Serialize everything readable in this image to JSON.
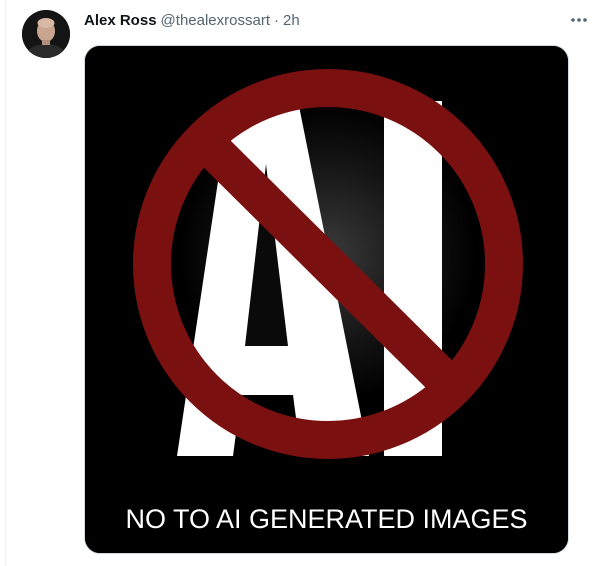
{
  "tweet": {
    "author": {
      "display_name": "Alex Ross",
      "handle": "@thealexrossart",
      "avatar_icon": "profile-photo"
    },
    "separator": "·",
    "timestamp": "2h",
    "more_icon": "more-horizontal-icon",
    "media": {
      "letters": "AI",
      "caption": "NO TO AI GENERATED IMAGES",
      "colors": {
        "prohibition_red": "#7a1010",
        "letters": "#ffffff",
        "background": "#000000"
      }
    }
  },
  "colors": {
    "text_primary": "#0f1419",
    "text_secondary": "#536471",
    "border": "#cfd9de"
  }
}
